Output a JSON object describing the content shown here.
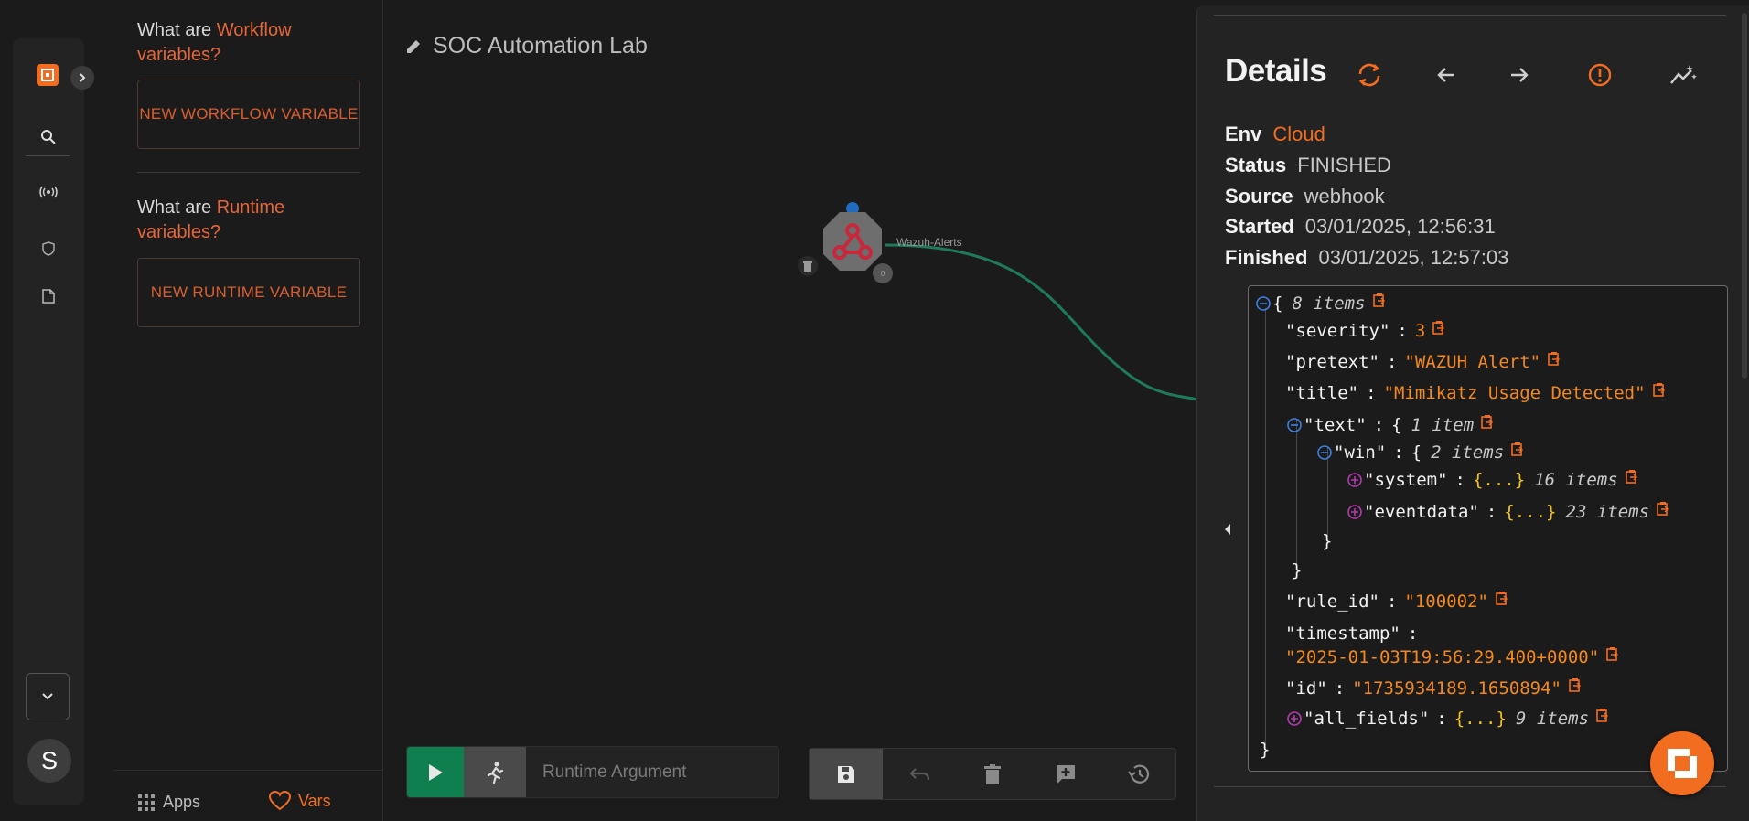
{
  "sidebar": {
    "avatar_letter": "S"
  },
  "vars_panel": {
    "workflow_q_prefix": "What are ",
    "workflow_q_accent": "Workflow variables?",
    "workflow_button": "NEW WORKFLOW VARIABLE",
    "runtime_q_prefix": "What are ",
    "runtime_q_accent": "Runtime variables?",
    "runtime_button": "NEW RUNTIME VARIABLE",
    "footer": {
      "apps_label": "Apps",
      "vars_label": "Vars"
    }
  },
  "canvas": {
    "workflow_title": "SOC Automation Lab",
    "node": {
      "label": "Wazuh-Alerts",
      "badge": "0"
    },
    "runtime_argument_placeholder": "Runtime Argument"
  },
  "details": {
    "title": "Details",
    "env_label": "Env",
    "env_value": "Cloud",
    "status_label": "Status",
    "status_value": "FINISHED",
    "source_label": "Source",
    "source_value": "webhook",
    "started_label": "Started",
    "started_value": "03/01/2025, 12:56:31",
    "finished_label": "Finished",
    "finished_value": "03/01/2025, 12:57:03",
    "json": {
      "root_count": "8 items",
      "severity_key": "\"severity\"",
      "severity_val": "3",
      "pretext_key": "\"pretext\"",
      "pretext_val": "\"WAZUH Alert\"",
      "title_key": "\"title\"",
      "title_val": "\"Mimikatz Usage Detected\"",
      "text_key": "\"text\"",
      "text_count": "1 item",
      "win_key": "\"win\"",
      "win_count": "2 items",
      "system_key": "\"system\"",
      "system_count": "16 items",
      "eventdata_key": "\"eventdata\"",
      "eventdata_count": "23 items",
      "rule_id_key": "\"rule_id\"",
      "rule_id_val": "\"100002\"",
      "timestamp_key": "\"timestamp\"",
      "timestamp_val": "\"2025-01-03T19:56:29.400+0000\"",
      "id_key": "\"id\"",
      "id_val": "\"1735934189.1650894\"",
      "all_fields_key": "\"all_fields\"",
      "all_fields_count": "9 items",
      "collapsed": "{...}"
    }
  },
  "colors": {
    "accent": "#f36d21",
    "run_green": "#0f7f4f",
    "edge_green": "#1e7a5a",
    "panel": "#232323",
    "bg": "#1b1b1b"
  }
}
